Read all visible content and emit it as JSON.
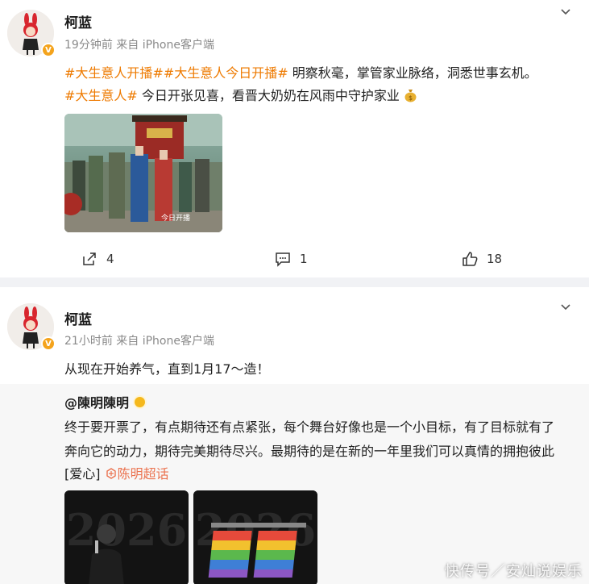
{
  "post1": {
    "username": "柯蓝",
    "meta": "19分钟前 来自 iPhone客户端",
    "line1_tags": "#大生意人开播##大生意人今日开播#",
    "line1_text": " 明察秋毫，掌管家业脉络，洞悉世事玄机。",
    "line2_tag": "#大生意人#",
    "line2_text": " 今日开张见喜，看晋大奶奶在风雨中守护家业",
    "money_bag_icon": "money-bag-icon",
    "image_caption": "今日开播",
    "actions": {
      "repost_count": "4",
      "comment_count": "1",
      "like_count": "18"
    }
  },
  "post2": {
    "username": "柯蓝",
    "meta": "21小时前 来自 iPhone客户端",
    "text": "从现在开始养气，直到1月17～造！",
    "repost": {
      "author": "@陳明陳明",
      "line1": "终于要开票了，有点期待还有点紧张，每个舞台好像也是一个小目标，有了目标就有了",
      "line2": "奔向它的动力，期待完美期待尽兴。最期待的是在新的一年里我们可以真情的拥抱彼此",
      "line3_emoji": "[爱心]",
      "line3_supertopic": "陈明超话",
      "image1_text": "2026",
      "image2_text": "2026"
    }
  },
  "watermark": "快传号／安灿说娱乐",
  "colors": {
    "tag": "#ee7a00",
    "divider": "#f1f2f5",
    "repost_bg": "#f7f7f7",
    "vip_badge": "#f4a31c"
  }
}
